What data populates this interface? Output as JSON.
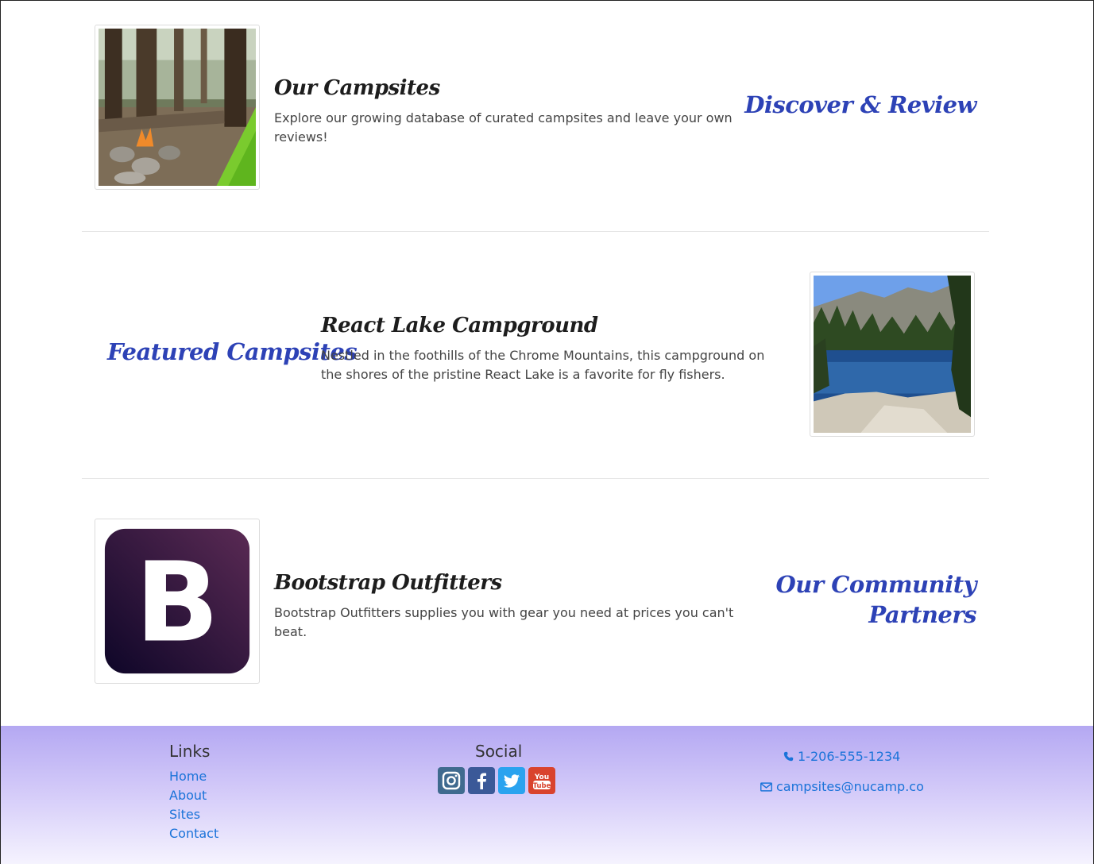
{
  "sections": [
    {
      "heading": "Our Campsites",
      "description": "Explore our growing database of curated campsites and leave your own reviews!",
      "tagline": "Discover & Review",
      "image": "campsite-forest-photo"
    },
    {
      "heading": "React Lake Campground",
      "description": "Nestled in the foothills of the Chrome Mountains, this campground on the shores of the pristine React Lake is a favorite for fly fishers.",
      "tagline": "Featured Campsites",
      "image": "mountain-lake-photo"
    },
    {
      "heading": "Bootstrap Outfitters",
      "description": "Bootstrap Outfitters supplies you with gear you need at prices you can't beat.",
      "tagline_lines": [
        "Our Community",
        "Partners"
      ],
      "image": "bootstrap-logo",
      "logo_letter": "B"
    }
  ],
  "footer": {
    "links_heading": "Links",
    "links": [
      "Home",
      "About",
      "Sites",
      "Contact"
    ],
    "social_heading": "Social",
    "social": [
      "instagram-icon",
      "facebook-icon",
      "twitter-icon",
      "youtube-icon"
    ],
    "phone": "1-206-555-1234",
    "email": "campsites@nucamp.co",
    "link_color": "#1a73d9",
    "gradient_top": "#b4a8f2"
  },
  "colors": {
    "tagline": "#2d42b6",
    "heading": "#1d1d1d"
  }
}
